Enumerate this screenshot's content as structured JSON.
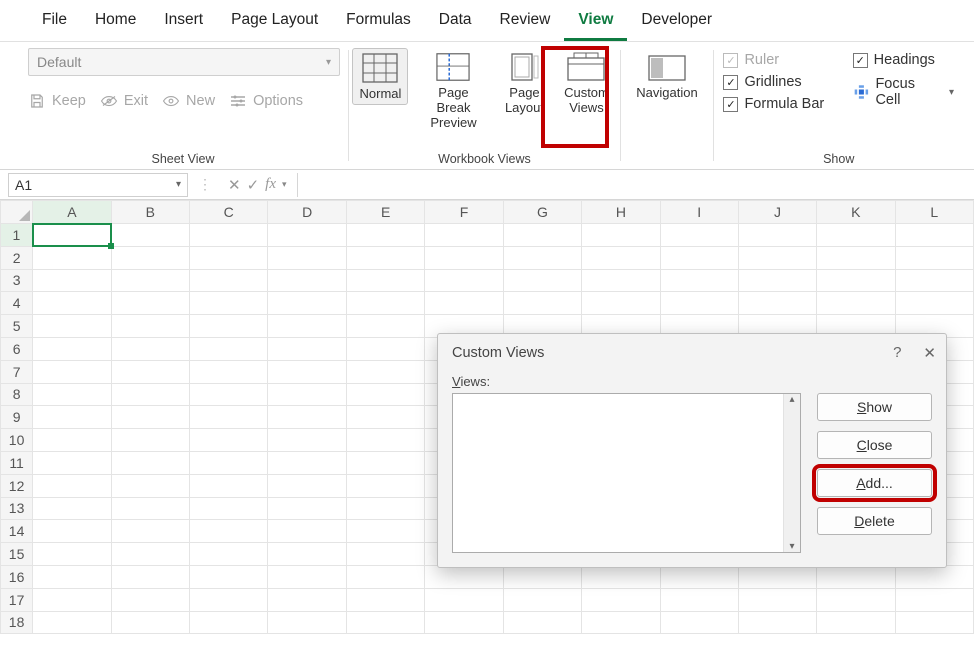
{
  "tabs": {
    "file": "File",
    "home": "Home",
    "insert": "Insert",
    "pagelayout": "Page Layout",
    "formulas": "Formulas",
    "data": "Data",
    "review": "Review",
    "view": "View",
    "developer": "Developer"
  },
  "sheetview": {
    "default": "Default",
    "keep": "Keep",
    "exit": "Exit",
    "new": "New",
    "options": "Options",
    "group": "Sheet View"
  },
  "workbookviews": {
    "normal": "Normal",
    "pagebreak": "Page Break Preview",
    "pagelayout": "Page Layout",
    "custom": "Custom Views",
    "group": "Workbook Views"
  },
  "nav": {
    "navigation": "Navigation"
  },
  "show": {
    "ruler": "Ruler",
    "gridlines": "Gridlines",
    "formula": "Formula Bar",
    "headings": "Headings",
    "focus": "Focus Cell",
    "group": "Show"
  },
  "fx": {
    "cell": "A1",
    "fx": "fx"
  },
  "cols": [
    "A",
    "B",
    "C",
    "D",
    "E",
    "F",
    "G",
    "H",
    "I",
    "J",
    "K",
    "L"
  ],
  "rows": [
    "1",
    "2",
    "3",
    "4",
    "5",
    "6",
    "7",
    "8",
    "9",
    "10",
    "11",
    "12",
    "13",
    "14",
    "15",
    "16",
    "17",
    "18"
  ],
  "dialog": {
    "title": "Custom Views",
    "views": "Views:",
    "show": "Show",
    "close": "Close",
    "add": "Add...",
    "delete": "Delete"
  }
}
